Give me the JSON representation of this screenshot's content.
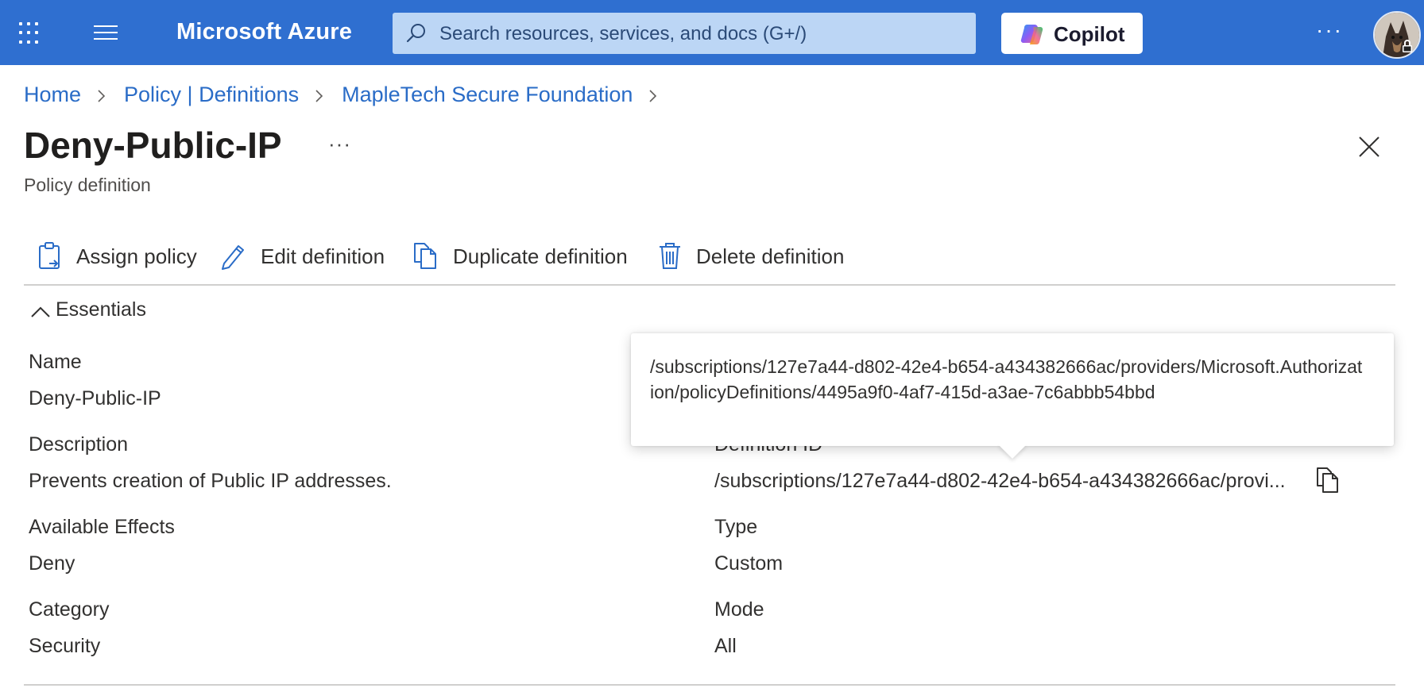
{
  "topbar": {
    "brand": "Microsoft Azure",
    "search_placeholder": "Search resources, services, and docs (G+/)",
    "copilot_label": "Copilot",
    "more_label": "···",
    "color": "#2f6fd0"
  },
  "breadcrumb": {
    "items": [
      "Home",
      "Policy | Definitions",
      "MapleTech Secure Foundation"
    ]
  },
  "header": {
    "title": "Deny-Public-IP",
    "more_label": "···",
    "subtitle": "Policy definition"
  },
  "toolbar": {
    "assign_label": "Assign policy",
    "edit_label": "Edit definition",
    "duplicate_label": "Duplicate definition",
    "delete_label": "Delete definition"
  },
  "essentials": {
    "label": "Essentials",
    "left": [
      {
        "label": "Name",
        "value": "Deny-Public-IP"
      },
      {
        "label": "Description",
        "value": "Prevents creation of Public IP addresses."
      },
      {
        "label": "Available Effects",
        "value": "Deny"
      },
      {
        "label": "Category",
        "value": "Security"
      }
    ],
    "right": [
      {
        "label": "Definition ID",
        "value": "/subscriptions/127e7a44-d802-42e4-b654-a434382666ac/provi..."
      },
      {
        "label": "Type",
        "value": "Custom"
      },
      {
        "label": "Mode",
        "value": "All"
      }
    ]
  },
  "tooltip": {
    "text": "/subscriptions/127e7a44-d802-42e4-b654-a434382666ac/providers/Microsoft.Authorization/policyDefinitions/4495a9f0-4af7-415d-a3ae-7c6abbb54bbd"
  }
}
